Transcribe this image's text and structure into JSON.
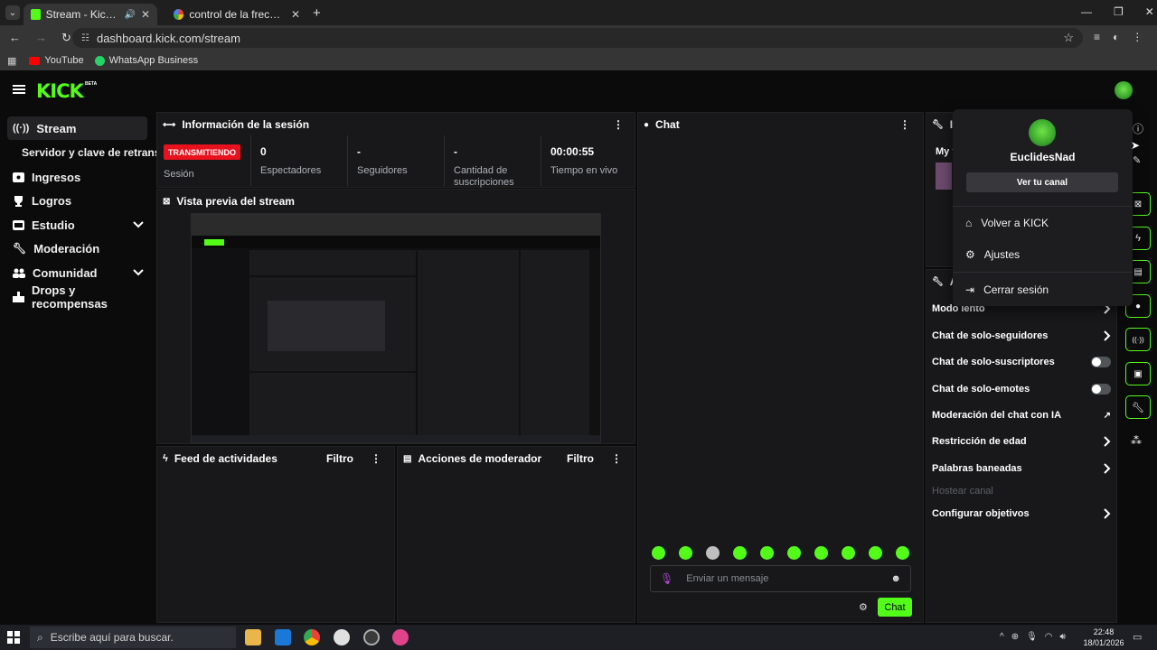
{
  "browser": {
    "tabs": [
      {
        "title": "Stream - Kick Dashboard",
        "active": true
      },
      {
        "title": "control de la frecuencia obs ch",
        "active": false
      }
    ],
    "url": "dashboard.kick.com/stream",
    "bookmarks": [
      "YouTube",
      "WhatsApp Business"
    ]
  },
  "brand": {
    "logo": "KICK",
    "badge": "BETA",
    "accent": "#53fc18"
  },
  "sidebar": {
    "items": [
      {
        "label": "Stream",
        "icon": "broadcast-icon",
        "active": true
      },
      {
        "label": "Servidor y clave de retransm",
        "icon": "",
        "sub": true
      },
      {
        "label": "Ingresos",
        "icon": "money-icon"
      },
      {
        "label": "Logros",
        "icon": "trophy-icon"
      },
      {
        "label": "Estudio",
        "icon": "studio-icon",
        "expandable": true
      },
      {
        "label": "Moderación",
        "icon": "wrench-icon"
      },
      {
        "label": "Comunidad",
        "icon": "community-icon",
        "expandable": true
      },
      {
        "label": "Drops y recompensas",
        "icon": "drops-icon"
      }
    ]
  },
  "session": {
    "title": "Información de la sesión",
    "status_badge": "TRANSMITIENDO",
    "stats": [
      {
        "value": "",
        "label": "Sesión"
      },
      {
        "value": "0",
        "label": "Espectadores"
      },
      {
        "value": "-",
        "label": "Seguidores"
      },
      {
        "value": "-",
        "label": "Cantidad de suscripciones"
      },
      {
        "value": "00:00:55",
        "label": "Tiempo en vivo"
      }
    ]
  },
  "preview": {
    "title": "Vista previa del stream"
  },
  "feed": {
    "title": "Feed de actividades",
    "filter": "Filtro"
  },
  "mod_actions": {
    "title": "Acciones de moderador",
    "filter": "Filtro"
  },
  "chat": {
    "title": "Chat",
    "input_placeholder": "Enviar un mensaje",
    "send_label": "Chat",
    "emote_count": 10
  },
  "stream_info": {
    "title_partial": "In",
    "my_partial": "My f"
  },
  "chat_settings": {
    "title_partial": "Ac",
    "rows": [
      {
        "label": "Modo lento",
        "control": "chevron"
      },
      {
        "label": "Chat de solo-seguidores",
        "control": "chevron"
      },
      {
        "label": "Chat de solo-suscriptores",
        "control": "toggle"
      },
      {
        "label": "Chat de solo-emotes",
        "control": "toggle"
      },
      {
        "label": "Moderación del chat con IA",
        "control": "external"
      },
      {
        "label": "Restricción de edad",
        "control": "chevron"
      },
      {
        "label": "Palabras baneadas",
        "control": "chevron"
      },
      {
        "label": "Hostear canal",
        "control": "none",
        "disabled": true
      },
      {
        "label": "Configurar objetivos",
        "control": "chevron"
      }
    ]
  },
  "user_menu": {
    "username": "EuclidesNad",
    "view_channel": "Ver tu canal",
    "items": [
      {
        "label": "Volver a KICK",
        "icon": "home-icon"
      },
      {
        "label": "Ajustes",
        "icon": "gear-icon"
      },
      {
        "label": "Cerrar sesión",
        "icon": "logout-icon"
      }
    ]
  },
  "taskbar": {
    "search_placeholder": "Escribe aquí para buscar.",
    "time": "22:48",
    "date": "18/01/2026"
  }
}
